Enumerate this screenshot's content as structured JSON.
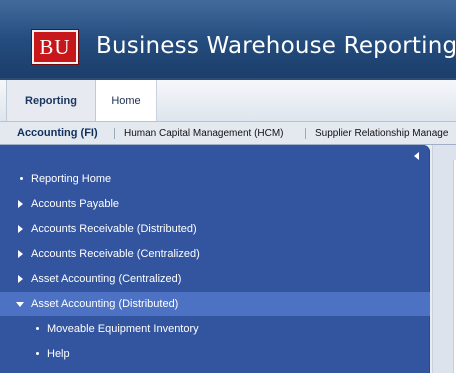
{
  "header": {
    "logo_text": "BU",
    "app_title": "Business Warehouse Reporting"
  },
  "tabs": [
    {
      "label": "Reporting",
      "active": true
    },
    {
      "label": "Home",
      "active": false
    }
  ],
  "subnav": [
    {
      "label": "Accounting (FI)",
      "active": true
    },
    {
      "label": "Human Capital Management (HCM)",
      "active": false
    },
    {
      "label": "Supplier Relationship Manage",
      "active": false
    }
  ],
  "nav": [
    {
      "label": "Reporting Home",
      "icon": "bullet-icon",
      "level": 1,
      "selected": false
    },
    {
      "label": "Accounts Payable",
      "icon": "expand-arrow-icon",
      "level": 1,
      "selected": false
    },
    {
      "label": "Accounts Receivable (Distributed)",
      "icon": "expand-arrow-icon",
      "level": 1,
      "selected": false
    },
    {
      "label": "Accounts Receivable (Centralized)",
      "icon": "expand-arrow-icon",
      "level": 1,
      "selected": false
    },
    {
      "label": "Asset Accounting (Centralized)",
      "icon": "expand-arrow-icon",
      "level": 1,
      "selected": false
    },
    {
      "label": "Asset Accounting (Distributed)",
      "icon": "collapse-arrow-icon",
      "level": 1,
      "selected": true
    },
    {
      "label": "Moveable Equipment Inventory",
      "icon": "bullet-icon",
      "level": 2,
      "selected": false
    },
    {
      "label": "Help",
      "icon": "bullet-icon",
      "level": 2,
      "selected": false
    }
  ],
  "colors": {
    "header": "#234b7c",
    "logo": "#c8171b",
    "nav_panel": "#3355a0",
    "nav_selected": "#4d72c3"
  }
}
